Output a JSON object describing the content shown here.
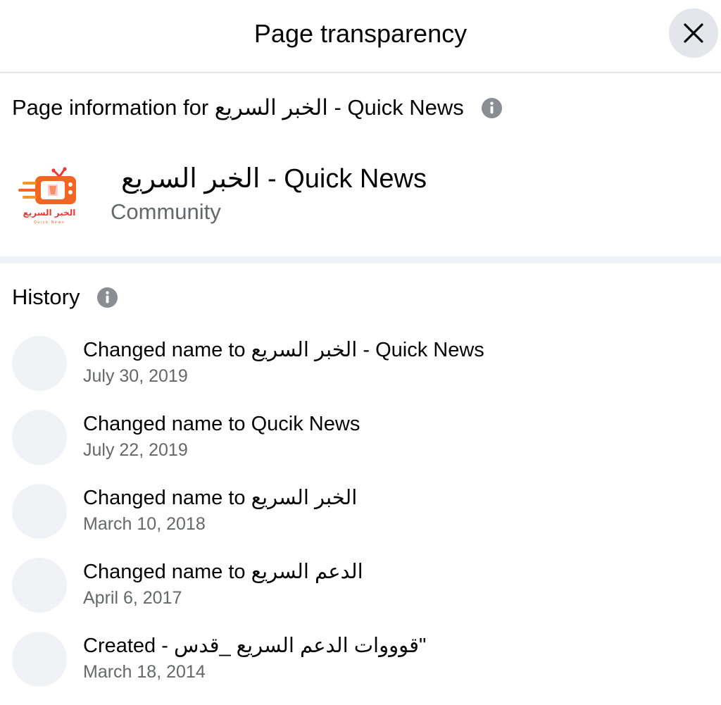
{
  "header": {
    "title": "Page transparency",
    "close_icon": "close-icon"
  },
  "page_info": {
    "section_title": "Page information for الخبر السريع - Quick News",
    "info_icon": "info-icon",
    "logo_icon": "retro-tv-logo",
    "logo_text": "الخبر السريع",
    "logo_subtext": "Quick News",
    "page_name": "الخبر السريع - Quick News",
    "category": "Community"
  },
  "history": {
    "section_title": "History",
    "info_icon": "info-icon",
    "items": [
      {
        "prefix": "Changed name to ",
        "value": "الخبر السريع - Quick News",
        "date": "July 30, 2019"
      },
      {
        "prefix": "Changed name to ",
        "value": "Qucik News",
        "date": "July 22, 2019"
      },
      {
        "prefix": "Changed name to ",
        "value": "الخبر السريع",
        "date": "March 10, 2018"
      },
      {
        "prefix": "Changed name to ",
        "value": "الدعم السريع",
        "date": "April 6, 2017"
      },
      {
        "prefix": "Created - ",
        "value": "قوووات الدعم السريع _قدس\"",
        "date": "March 18, 2014"
      }
    ]
  },
  "colors": {
    "primary_text": "#050505",
    "secondary_text": "#65676b",
    "divider": "#e4e6eb",
    "avatar_placeholder": "#f0f2f5",
    "logo_orange": "#f26522",
    "logo_red": "#e53935",
    "info_icon": "#8a8d91"
  }
}
